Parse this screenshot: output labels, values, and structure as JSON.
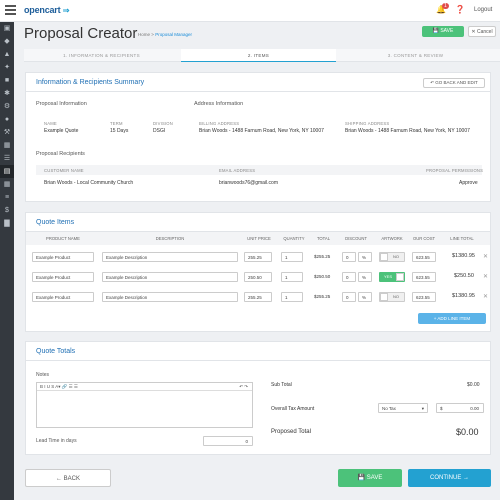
{
  "topbar": {
    "logo": "opencart",
    "notif_count": "1",
    "logout": "Logout"
  },
  "page": {
    "title": "Proposal Creator",
    "crumb_home": "Home",
    "crumb_sep": ">",
    "crumb_current": "Proposal Manager",
    "save": "SAVE",
    "cancel": "Cancel"
  },
  "steps": [
    "1. INFORMATION & RECIPIENTS",
    "2. ITEMS",
    "3. CONTENT & REVIEW"
  ],
  "summary": {
    "heading": "Information & Recipients Summary",
    "go_back": "GO BACK AND EDIT",
    "proposal_info": "Proposal Information",
    "address_info": "Address Information",
    "name_lbl": "NAME",
    "name": "Example Quote",
    "term_lbl": "TERM",
    "term": "15 Days",
    "division_lbl": "DIVISION",
    "division": "DSGI",
    "billing_lbl": "BILLING ADDRESS",
    "billing": "Brian Woods - 1488 Farnum Road, New York, NY 10007",
    "shipping_lbl": "SHIPPING ADDRESS",
    "shipping": "Brian Woods - 1488 Farnum Road, New York, NY 10007",
    "recipients": "Proposal Recipients",
    "cust_lbl": "CUSTOMER NAME",
    "email_lbl": "EMAIL ADDRESS",
    "perm_lbl": "PROPOSAL PERMISSIONS",
    "cust": "Brian Woods - Local Community Church",
    "email": "brianwoods76@gmail.com",
    "perm": "Approve"
  },
  "items": {
    "heading": "Quote Items",
    "headers": [
      "PRODUCT NAME",
      "DESCRIPTION",
      "UNIT PRICE",
      "QUANTITY",
      "TOTAL",
      "DISCOUNT",
      "ARTWORK",
      "OUR COST",
      "LINE TOTAL"
    ],
    "rows": [
      {
        "product": "Example Product",
        "desc": "Example Description",
        "price": "255.25",
        "qty": "1",
        "total": "$255.25",
        "disc": "0",
        "disc_unit": "%",
        "art": "NO",
        "cost": "623.55",
        "line": "$1380.95"
      },
      {
        "product": "Example Product",
        "desc": "Example Description",
        "price": "250.50",
        "qty": "1",
        "total": "$250.50",
        "disc": "0",
        "disc_unit": "%",
        "art": "YES",
        "cost": "623.55",
        "line": "$250.50"
      },
      {
        "product": "Example Product",
        "desc": "Example Description",
        "price": "255.25",
        "qty": "1",
        "total": "$255.25",
        "disc": "0",
        "disc_unit": "%",
        "art": "NO",
        "cost": "623.55",
        "line": "$1380.95"
      }
    ],
    "add_line": "+ ADD LINE ITEM"
  },
  "totals": {
    "heading": "Quote Totals",
    "notes": "Notes",
    "toolbar": "B   I   U   S   A▾   🔗   ☰   ☰",
    "lead_time": "Lead Time in days",
    "lead_value": "0",
    "subtotal_lbl": "Sub Total",
    "subtotal": "$0.00",
    "tax_lbl": "Overall Tax Amount",
    "tax_select": "No Tax",
    "tax_currency": "$",
    "tax_value": "0.00",
    "proposed_lbl": "Proposed Total",
    "proposed": "$0.00"
  },
  "bottom": {
    "back": "BACK",
    "save": "SAVE",
    "continue": "CONTINUE"
  }
}
